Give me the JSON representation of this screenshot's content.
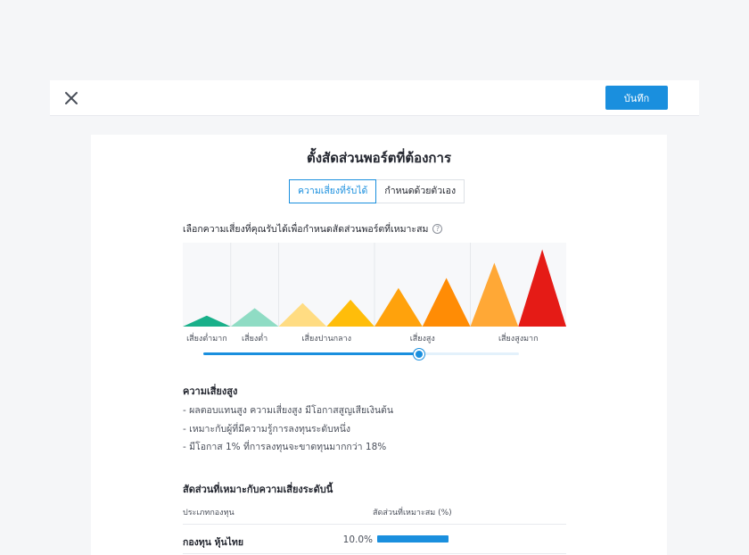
{
  "header": {
    "save_label": "บันทึก"
  },
  "card": {
    "title": "ตั้งสัดส่วนพอร์ตที่ต้องการ",
    "tabs": [
      {
        "label": "ความเสี่ยงที่รับได้",
        "active": true
      },
      {
        "label": "กำหนดด้วยตัวเอง",
        "active": false
      }
    ],
    "instruction": "เลือกความเสี่ยงที่คุณรับได้เพื่อกำหนดสัดส่วนพอร์ตที่เหมาะสม",
    "info_icon_glyph": "?"
  },
  "risk_chart": {
    "levels": [
      {
        "color": "#19b08a",
        "height": 0.13
      },
      {
        "color": "#8fdcc4",
        "height": 0.22
      },
      {
        "color": "#ffdc82",
        "height": 0.28
      },
      {
        "color": "#ffbd0a",
        "height": 0.32
      },
      {
        "color": "#ffa20c",
        "height": 0.46
      },
      {
        "color": "#ff8c05",
        "height": 0.58
      },
      {
        "color": "#ffa836",
        "height": 0.76
      },
      {
        "color": "#e51b16",
        "height": 0.92
      }
    ],
    "labels": [
      "เสี่ยงต่ำมาก",
      "เสี่ยงต่ำ",
      "เสี่ยงปานกลาง",
      "เสี่ยงสูง",
      "เสี่ยงสูงมาก"
    ],
    "selected_fraction": 0.685
  },
  "risk_detail": {
    "title": "ความเสี่ยงสูง",
    "bullets": [
      "- ผลตอบแทนสูง ความเสี่ยงสูง มีโอกาสสูญเสียเงินต้น",
      "- เหมาะกับผู้ที่มีความรู้การลงทุนระดับหนึ่ง",
      "- มีโอกาส 1% ที่การลงทุนจะขาดทุนมากกว่า 18%"
    ]
  },
  "allocation": {
    "title": "สัดส่วนที่เหมาะกับความเสี่ยงระดับนี้",
    "col_type": "ประเภทกองทุน",
    "col_ratio": "สัดส่วนที่เหมาะสม (%)",
    "rows": [
      {
        "fund": "กองทุน หุ้นไทย",
        "pct": "10.0%",
        "value": 10.0
      }
    ]
  }
}
